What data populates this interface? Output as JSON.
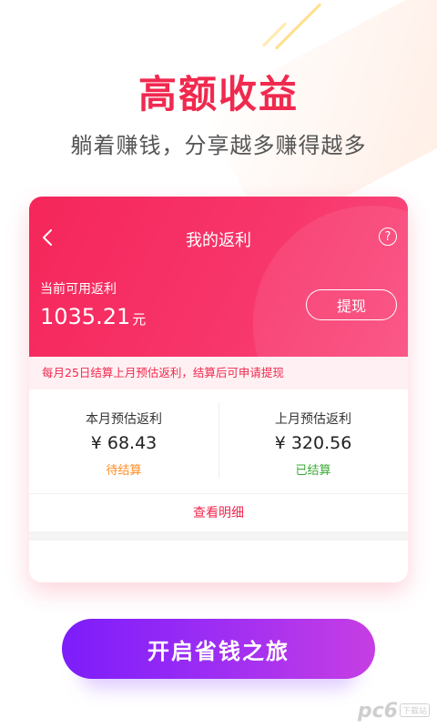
{
  "promo": {
    "headline": "高额收益",
    "subheadline": "躺着赚钱，分享越多赚得越多"
  },
  "card": {
    "nav_title": "我的返利",
    "available_label": "当前可用返利",
    "available_amount": "1035.21",
    "available_unit": "元",
    "withdraw_label": "提现",
    "notice": "每月25日结算上月预估返利，结算后可申请提现",
    "stats": [
      {
        "title": "本月预估返利",
        "value": "¥ 68.43",
        "status": "待结算"
      },
      {
        "title": "上月预估返利",
        "value": "¥ 320.56",
        "status": "已结算"
      }
    ],
    "details_link": "查看明细"
  },
  "cta": {
    "label": "开启省钱之旅"
  },
  "watermark": {
    "brand": "pc6",
    "tag": "下载站"
  },
  "colors": {
    "accent": "#f0294f",
    "pending": "#ff8a1f",
    "settled": "#3aaa35",
    "cta_start": "#7d1dfa",
    "cta_end": "#c63ee3"
  },
  "icons": {
    "back": "chevron-left-icon",
    "help": "question-circle-icon"
  }
}
